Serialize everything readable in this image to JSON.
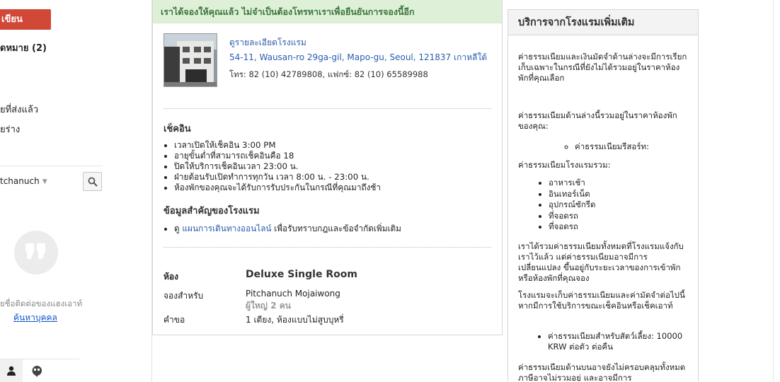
{
  "sidebar": {
    "compose_label": "เขียน",
    "inbox_label": "ดหมาย (2)",
    "sent_label": "ยที่ส่งแล้ว",
    "drafts_label": "ยร่าง",
    "hangouts": {
      "user_name": "tchanuch",
      "empty_hint": "ยชื่อติดต่อของแฮงเอาท์",
      "find_link": "ค้นหาบุคคล"
    }
  },
  "confirmation": {
    "banner": "เราได้จองให้คุณแล้ว ไม่จำเป็นต้องโทรหาเราเพื่อยืนยันการจองนี้อีก",
    "hotel": {
      "details_link": "ดูรายละเอียดโรงแรม",
      "address": "54-11, Wausan-ro 29ga-gil, Mapo-gu, Seoul, 121837 เกาหลีใต้",
      "phone_fax": "โทร: 82 (10) 42789808, แฟกซ์: 82 (10) 65589988"
    },
    "checkin": {
      "title": "เช็คอิน",
      "items": [
        "เวลาเปิดให้เช็คอิน 3:00 PM",
        "อายุขั้นต่ำที่สามารถเช็คอินคือ 18",
        "ปิดให้บริการเช็คอินเวลา 23:00 น.",
        "ฝ่ายต้อนรับเปิดทำการทุกวัน เวลา 8:00 น. - 23:00 น.",
        "ห้องพักของคุณจะได้รับการรับประกันในกรณีที่คุณมาถึงช้า"
      ]
    },
    "important": {
      "title": "ข้อมูลสำคัญของโรงแรม",
      "prefix": "ดู ",
      "link": "แผนการเดินทางออนไลน์",
      "suffix": " เพื่อรับทราบกฎและข้อจำกัดเพิ่มเติม"
    },
    "room": {
      "room_label": "ห้อง",
      "room_value": "Deluxe Single Room",
      "booked_for_label": "จองสำหรับ",
      "guest_name": "Pitchanuch Mojaiwong",
      "guest_count": "ผู้ใหญ่ 2 คน",
      "request_label": "คำขอ",
      "request_value": "1 เตียง, ห้องแบบไม่สูบบุหรี่"
    }
  },
  "extra_services": {
    "title": "บริการจากโรงแรมเพิ่มเติม",
    "fees_intro": "ค่าธรรมเนียมและเงินมัดจำด้านล่างจะมีการเรียกเก็บเฉพาะในกรณีที่ยังไม่ได้รวมอยู่ในราคาห้องพักที่คุณเลือก",
    "included_intro": "ค่าธรรมเนียมด้านล่างนี้รวมอยู่ในราคาห้องพักของคุณ:",
    "resort_fee": "ค่าธรรมเนียมรีสอร์ท:",
    "hotel_fees_title": "ค่าธรรมเนียมโรงแรมรวม:",
    "hotel_fees": [
      "อาหารเช้า",
      "อินเทอร์เน็ต",
      "อุปกรณ์ซักรีด",
      "ที่จอดรถ",
      "ที่จอดรถ"
    ],
    "disclaimer": "เราได้รวมค่าธรรมเนียมทั้งหมดที่โรงแรมแจ้งกับเราไว้แล้ว แต่ค่าธรรมเนียมอาจมีการเปลี่ยนแปลง ขึ้นอยู่กับระยะเวลาของการเข้าพักหรือห้องพักที่คุณจอง",
    "collect_note": "โรงแรมจะเก็บค่าธรรมเนียมและค่ามัดจำต่อไปนี้หากมีการใช้บริการขณะเช็คอินหรือเช็คเอาท์",
    "pet_fee": "ค่าธรรมเนียมสำหรับสัตว์เลี้ยง: 10000 KRW ต่อตัว ต่อคืน",
    "bottom_text": "ค่าธรรมเนียมด้านบนอาจยังไม่ครอบคลุมทั้งหมด ภาษีอาจไม่รวมอยู่ และอาจมีการ"
  },
  "colors": {
    "compose": "#d14836",
    "banner_bg": "#dff0d8",
    "banner_text": "#3c763d",
    "link": "#2a5db0"
  }
}
